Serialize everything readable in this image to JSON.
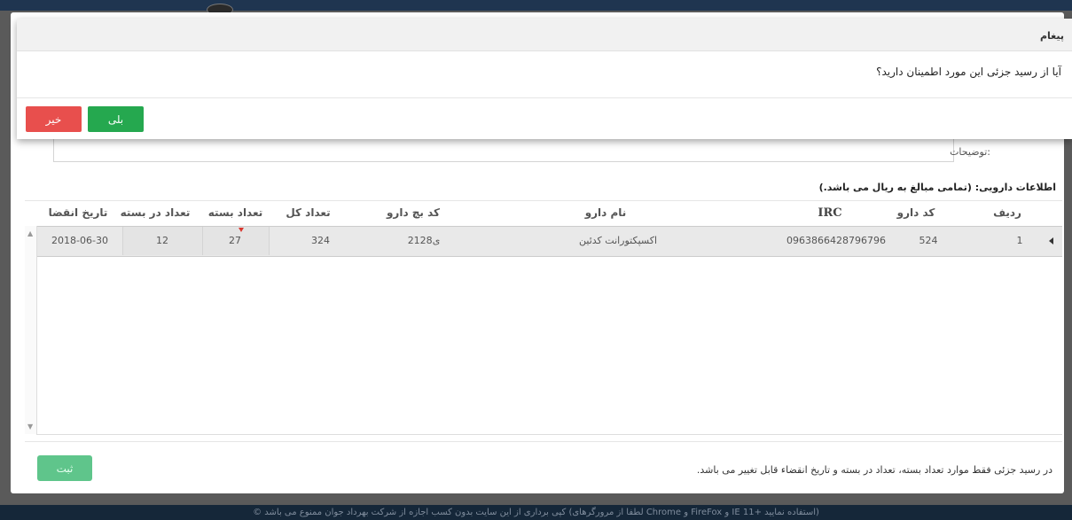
{
  "footer": {
    "text": "© کپی برداری از این سایت بدون کسب اجازه از شرکت بهرداد جوان ممنوع می باشد (لطفا از مرورگرهای Chrome و FireFox و IE 11+ استفاده نمایید)"
  },
  "form": {
    "description_label": "توضیحات:",
    "drug_info_label": "اطلاعات دارویی: (تمامی مبالغ به ریال می باشد.)",
    "note": "در رسید جزئی فقط موارد تعداد بسته، تعداد در بسته و تاریخ انقضاء قابل تغییر می باشد.",
    "submit_label": "ثبت"
  },
  "grid": {
    "columns": {
      "row": "ردیف",
      "drug_code": "کد دارو",
      "irc": "IRC",
      "drug_name": "نام دارو",
      "batch_code": "کد بچ دارو",
      "total_count": "تعداد کل",
      "package_count": "تعداد بسته",
      "count_per_package": "تعداد در بسته",
      "expiry_date": "تاریخ انقضا"
    },
    "rows": [
      {
        "row": "1",
        "drug_code": "524",
        "irc": "0963866428796796",
        "drug_name": "اکسپکتورانت کدئین",
        "batch_code": "2128ی",
        "total_count": "324",
        "package_count": "27",
        "count_per_package": "12",
        "expiry_date": "2018-06-30"
      }
    ]
  },
  "modal": {
    "title": "پیغام",
    "message": "آیا از رسید جزئی این مورد اطمینان دارید؟",
    "yes_label": "بلی",
    "no_label": "خیر"
  },
  "colors": {
    "yes_button": "#25a84f",
    "no_button": "#e84f4d",
    "submit_button": "#5fc58b",
    "edited_marker": "#d9362e"
  },
  "icons": {
    "row_indicator": "triangle-left-icon",
    "scroll_up": "scroll-up-arrow-icon",
    "scroll_down": "scroll-down-arrow-icon"
  }
}
